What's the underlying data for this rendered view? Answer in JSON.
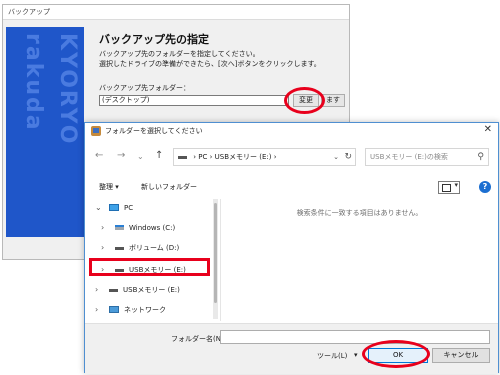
{
  "backup_window": {
    "title": "バックアップ",
    "banner_logo_text": "KYORYO rakuda",
    "heading": "バックアップ先の指定",
    "description_line1": "バックアップ先のフォルダーを指定してください。",
    "description_line2": "選択したドライブの準備ができたら、[次へ]ボタンをクリックします。",
    "folder_label": "バックアップ先フォルダー：",
    "folder_value": "(デスクトップ)",
    "change_button": "変更",
    "browse_button": "ます"
  },
  "folder_dialog": {
    "title": "フォルダーを選択してください",
    "address": {
      "crumb_pc": "PC",
      "crumb_drive": "USBメモリー (E:)"
    },
    "search_placeholder": "USBメモリー (E:)の検索",
    "toolbar": {
      "organize": "整理",
      "new_folder": "新しいフォルダー"
    },
    "tree": [
      {
        "label": "PC"
      },
      {
        "label": "Windows (C:)"
      },
      {
        "label": "ボリューム (D:)"
      },
      {
        "label": "USBメモリー (E:)"
      },
      {
        "label": "USBメモリー (E:)"
      },
      {
        "label": "ネットワーク"
      }
    ],
    "empty_message": "検索条件に一致する項目はありません。",
    "folder_name_label": "フォルダー名(N):",
    "folder_name_value": "",
    "tools_button": "ツール(L)",
    "ok_button": "OK",
    "cancel_button": "キャンセル"
  },
  "icons": {
    "close": "close-icon",
    "back": "arrow-left-icon",
    "forward": "arrow-right-icon",
    "up": "arrow-up-icon",
    "refresh": "refresh-icon",
    "search": "search-icon",
    "help": "help-icon"
  },
  "colors": {
    "banner": "#1f56c9",
    "annotation_red": "#e8001c",
    "accent": "#0078d7"
  }
}
